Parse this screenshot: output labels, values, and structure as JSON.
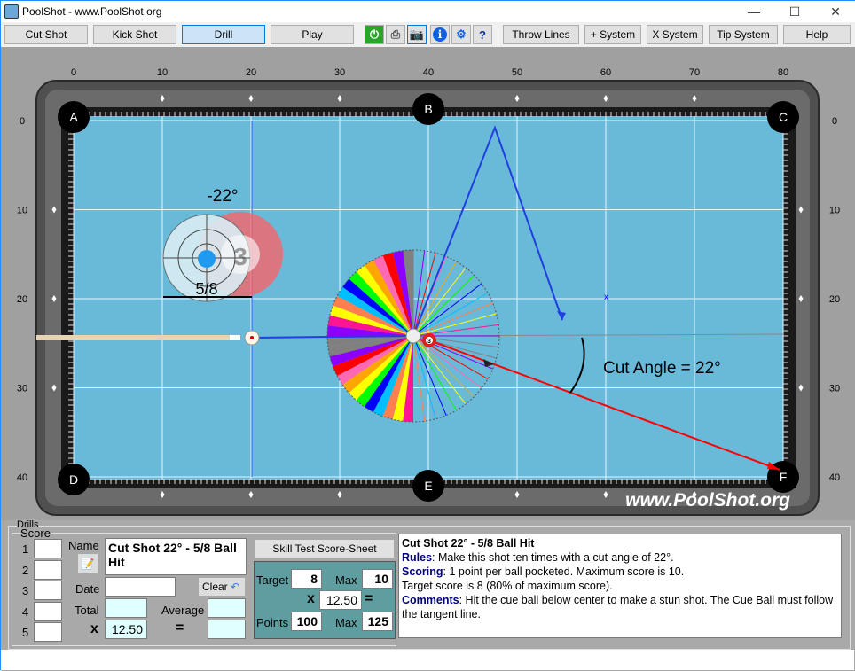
{
  "window": {
    "title": "PoolShot - www.PoolShot.org",
    "minimize": "—",
    "maximize": "☐",
    "close": "✕"
  },
  "toolbar": {
    "buttons": [
      "Cut Shot",
      "Kick Shot",
      "Drill",
      "Play"
    ],
    "active": "Drill",
    "icons": [
      "power-icon",
      "printer-icon",
      "camera-icon",
      "info-icon",
      "settings-gear-icon",
      "help-document-icon"
    ],
    "right_buttons": [
      "Throw Lines",
      "+ System",
      "X System",
      "Tip System",
      "Help"
    ]
  },
  "table": {
    "x_ticks": [
      "0",
      "10",
      "20",
      "30",
      "40",
      "50",
      "60",
      "70",
      "80"
    ],
    "y_ticks": [
      "0",
      "10",
      "20",
      "30",
      "40"
    ],
    "pockets": [
      "A",
      "B",
      "C",
      "D",
      "E",
      "F"
    ],
    "watermark": "www.PoolShot.org",
    "cut_angle_label": "Cut Angle = 22°",
    "ball_number": "3",
    "aim_angle": "-22°",
    "ball_hit": "5/8",
    "colors": {
      "felt": "#69b9d9",
      "rail": "#5a5a5a",
      "aim_line": "#0000ff",
      "object_path": "#ff0000"
    }
  },
  "drills": {
    "group_label": "Drills",
    "score_label": "Score",
    "score_rows": [
      "1",
      "2",
      "3",
      "4",
      "5"
    ],
    "name_label": "Name",
    "name_value": "Cut Shot 22° - 5/8 Ball Hit",
    "date_label": "Date",
    "date_value": "",
    "clear_label": "Clear",
    "total_label": "Total",
    "total_value": "",
    "average_label": "Average",
    "average_value": "",
    "x_label": "x",
    "multiplier": "12.50",
    "equals": "=",
    "result_value": "",
    "scoresheet_button": "Skill Test Score-Sheet",
    "target_label": "Target",
    "target_value": "8",
    "max_label": "Max",
    "max_value": "10",
    "sheet_multiplier": "12.50",
    "points_label": "Points",
    "points_value": "100",
    "max_points_value": "125"
  },
  "description": {
    "title": "Cut Shot 22° - 5/8 Ball Hit",
    "rules_label": "Rules",
    "rules": ": Make this shot ten times with a cut-angle of 22°.",
    "scoring_label": "Scoring",
    "scoring": ": 1 point per ball pocketed. Maximum score is 10.",
    "target": "Target score is 8 (80% of maximum score).",
    "comments_label": "Comments",
    "comments": ": Hit the cue ball below center to make a stun shot. The Cue Ball must follow the tangent line."
  }
}
